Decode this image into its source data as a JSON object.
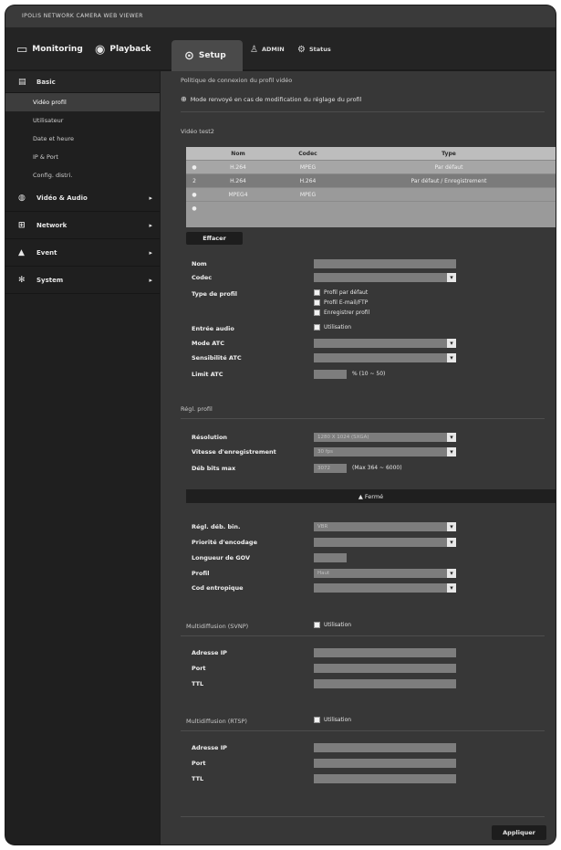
{
  "window": {
    "title": "IPOLIS NETWORK CAMERA WEB VIEWER"
  },
  "topnav": {
    "monitoring": "Monitoring",
    "playback": "Playback",
    "setup": "Setup",
    "user": "ADMIN",
    "status": "Status"
  },
  "sidebar": {
    "basic": "Basic",
    "items": [
      "Vidéo profil",
      "Utilisateur",
      "Date et heure",
      "IP & Port",
      "Config. distri."
    ],
    "categories": [
      "Vidéo & Audio",
      "Network",
      "Event",
      "System"
    ]
  },
  "content": {
    "title": "Politique de connexion du profil vidéo",
    "note": "Mode renvoyé en cas de modification du réglage du profil",
    "profile_section": "Vidéo test2",
    "table": {
      "headers": [
        "",
        "Nom",
        "Codec",
        "Type"
      ],
      "rows": [
        [
          "",
          "H.264",
          "MPEG",
          "Par défaut"
        ],
        [
          "2",
          "H.264",
          "H.264",
          "Par défaut / Enregistrement"
        ],
        [
          "",
          "MPEG4",
          "MPEG",
          ""
        ],
        [
          "",
          "",
          "",
          ""
        ]
      ]
    },
    "delete_button": "Effacer",
    "fields": {
      "name_label": "Nom",
      "codec_label": "Codec",
      "type_label": "Type de profil",
      "type_options": [
        "Profil par défaut",
        "Profil E-mail/FTP",
        "Enregistrer profil"
      ],
      "audio_label": "Entrée audio",
      "audio_use": "Utilisation",
      "atc_mode_label": "Mode ATC",
      "atc_sens_label": "Sensibilité ATC",
      "atc_limit_label": "Limit ATC",
      "atc_limit_hint": "% (10 ~ 50)"
    },
    "basic_section": "Régl. profil",
    "basic": {
      "resolution_label": "Résolution",
      "resolution_value": "1280 X 1024 (SXGA)",
      "framerate_label": "Vitesse d'enregistrement",
      "framerate_value": "30 fps",
      "bitrate_label": "Déb bits max",
      "bitrate_value": "3072",
      "bitrate_hint": "(Max 364 ~ 6000)"
    },
    "collapse_bar": "▲ Fermé",
    "advanced": {
      "control_label": "Régl. déb. bin.",
      "control_value": "VBR",
      "priority_label": "Priorité d'encodage",
      "gov_label": "Longueur de GOV",
      "profile_label": "Profil",
      "profile_value": "Haut",
      "entropy_label": "Cod entropique"
    },
    "multicast_svnp": {
      "label": "Multidiffusion (SVNP)",
      "use": "Utilisation",
      "ip_label": "Adresse IP",
      "port_label": "Port",
      "ttl_label": "TTL"
    },
    "multicast_rtsp": {
      "label": "Multidiffusion (RTSP)",
      "use": "Utilisation",
      "ip_label": "Adresse IP",
      "port_label": "Port",
      "ttl_label": "TTL"
    },
    "apply_button": "Appliquer"
  }
}
